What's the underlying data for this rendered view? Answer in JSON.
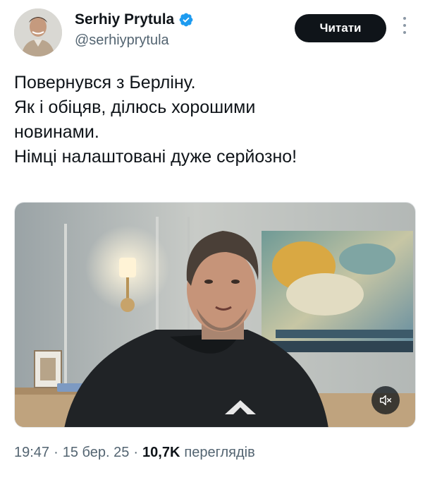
{
  "author": {
    "display_name": "Serhiy Prytula",
    "handle": "@serhiyprytula",
    "verified": true,
    "verified_color": "#1d9bf0"
  },
  "follow_button": {
    "label": "Читати"
  },
  "tweet": {
    "lines": [
      "Повернувся з Берліну.",
      "Як і обіцяв, ділюсь хорошими",
      "новинами.",
      "Німці налаштовані дуже серйозно!"
    ]
  },
  "media": {
    "type": "video",
    "muted_icon": "speaker-muted-icon"
  },
  "meta": {
    "time": "19:47",
    "date": "15 бер. 25",
    "views_count": "10,7K",
    "views_label": "переглядів",
    "separator": "·"
  },
  "colors": {
    "text_primary": "#0f1419",
    "text_secondary": "#536471",
    "button_bg": "#0f1419"
  }
}
